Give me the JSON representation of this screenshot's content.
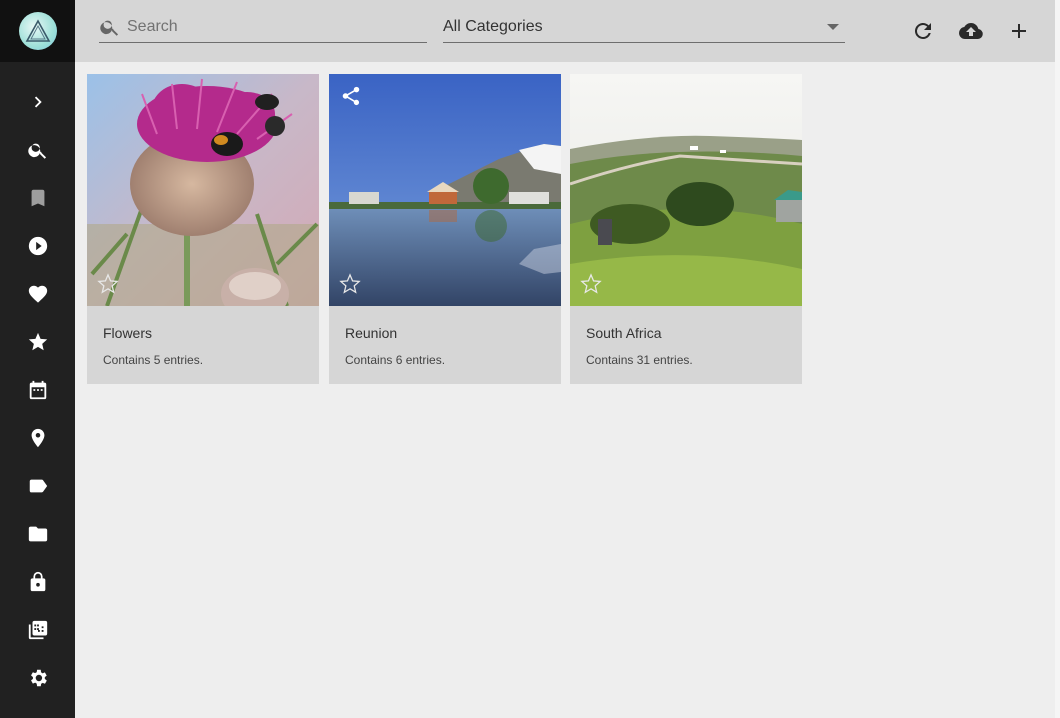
{
  "sidebar": {
    "items": [
      {
        "icon": "chevron-right-icon",
        "name": "expand"
      },
      {
        "icon": "search-icon",
        "name": "search"
      },
      {
        "icon": "bookmark-icon",
        "name": "review"
      },
      {
        "icon": "play-circle-icon",
        "name": "videos"
      },
      {
        "icon": "heart-icon",
        "name": "favorites"
      },
      {
        "icon": "star-icon",
        "name": "albums"
      },
      {
        "icon": "calendar-icon",
        "name": "calendar"
      },
      {
        "icon": "location-pin-icon",
        "name": "places"
      },
      {
        "icon": "label-icon",
        "name": "labels"
      },
      {
        "icon": "folder-icon",
        "name": "folders"
      },
      {
        "icon": "lock-icon",
        "name": "private"
      },
      {
        "icon": "library-icon",
        "name": "library"
      },
      {
        "icon": "gear-icon",
        "name": "settings"
      }
    ]
  },
  "toolbar": {
    "search_placeholder": "Search",
    "category_value": "All Categories",
    "buttons": [
      "refresh-icon",
      "cloud-upload-icon",
      "add-icon"
    ]
  },
  "albums": [
    {
      "title": "Flowers",
      "subtitle": "Contains 5 entries.",
      "shared": false
    },
    {
      "title": "Reunion",
      "subtitle": "Contains 6 entries.",
      "shared": true
    },
    {
      "title": "South Africa",
      "subtitle": "Contains 31 entries.",
      "shared": false
    }
  ],
  "colors": {
    "sidebar": "#212121",
    "toolbar": "#d6d6d6",
    "background": "#eeeeee",
    "card": "#d6d6d6"
  }
}
